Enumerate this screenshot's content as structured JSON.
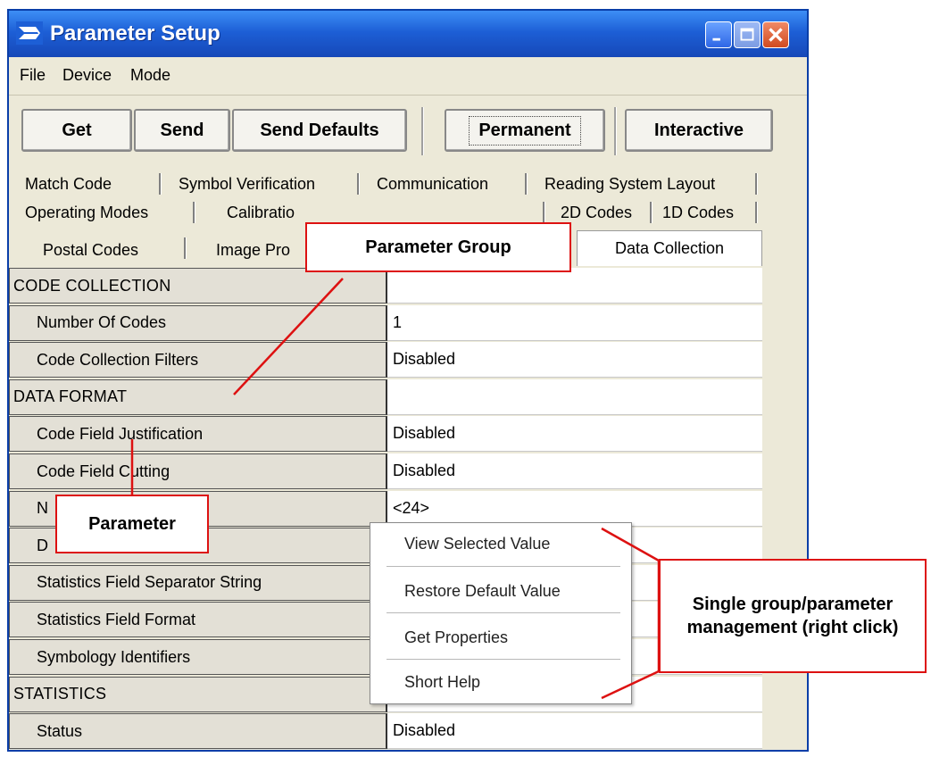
{
  "window": {
    "title": "Parameter Setup",
    "icon": "app-logo-icon",
    "controls": [
      "minimize-icon",
      "maximize-icon",
      "close-icon"
    ]
  },
  "menu": [
    "File",
    "Device",
    "Mode"
  ],
  "toolbar": {
    "get": "Get",
    "send": "Send",
    "send_defaults": "Send Defaults",
    "permanent": "Permanent",
    "interactive": "Interactive"
  },
  "tabs": {
    "row1": [
      "Match Code",
      "Symbol Verification",
      "Communication",
      "Reading System Layout"
    ],
    "row2": [
      "Operating Modes",
      "Calibratio",
      "2D Codes",
      "1D Codes"
    ],
    "row3": [
      "Postal Codes",
      "Image Pro"
    ],
    "active": "Data Collection"
  },
  "rows": [
    {
      "label": "CODE COLLECTION",
      "value": "",
      "kind": "group"
    },
    {
      "label": "Number Of Codes",
      "value": "1",
      "kind": "param"
    },
    {
      "label": "Code Collection Filters",
      "value": "Disabled",
      "kind": "param"
    },
    {
      "label": "DATA FORMAT",
      "value": "",
      "kind": "group"
    },
    {
      "label": "Code Field Justification",
      "value": "Disabled",
      "kind": "param"
    },
    {
      "label": "Code Field Cutting",
      "value": "Disabled",
      "kind": "param"
    },
    {
      "label": "N",
      "value": "<24>",
      "kind": "param"
    },
    {
      "label": "D",
      "value": "",
      "kind": "param"
    },
    {
      "label": "Statistics Field Separator String",
      "value": "",
      "kind": "param"
    },
    {
      "label": "Statistics Field Format",
      "value": "",
      "kind": "param"
    },
    {
      "label": "Symbology Identifiers",
      "value": "",
      "kind": "param"
    },
    {
      "label": "STATISTICS",
      "value": "",
      "kind": "group"
    },
    {
      "label": "Status",
      "value": "Disabled",
      "kind": "param"
    }
  ],
  "context_menu": [
    "View Selected Value",
    "Restore Default Value",
    "Get Properties",
    "Short Help"
  ],
  "callouts": {
    "group": "Parameter Group",
    "parameter": "Parameter",
    "management": "Single group/parameter management (right click)"
  },
  "colors": {
    "titlebar": "#1d5fd6",
    "callout_border": "#dd1111",
    "window_bg": "#ece9d8"
  }
}
